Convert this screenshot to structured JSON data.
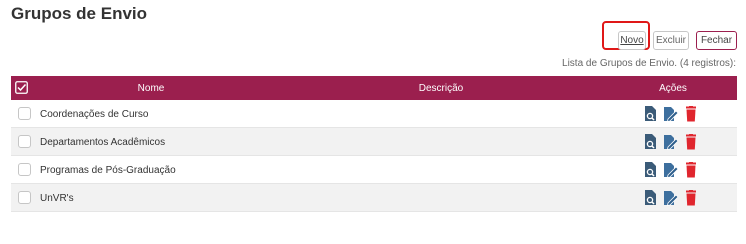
{
  "page": {
    "title": "Grupos de Envio"
  },
  "toolbar": {
    "new_label": "Novo",
    "delete_label": "Excluir",
    "close_label": "Fechar"
  },
  "list": {
    "caption": "Lista de Grupos de Envio. (4 registros):",
    "headers": {
      "name": "Nome",
      "description": "Descrição",
      "actions": "Ações"
    },
    "rows": [
      {
        "name": "Coordenações de Curso",
        "description": ""
      },
      {
        "name": "Departamentos Acadêmicos",
        "description": ""
      },
      {
        "name": "Programas de Pós-Graduação",
        "description": ""
      },
      {
        "name": "UnVR's",
        "description": ""
      }
    ]
  },
  "colors": {
    "header_bg": "#9b1f4e",
    "highlight": "#e01818",
    "view_icon": "#3b5b78",
    "edit_icon": "#3d6f9e",
    "delete_icon": "#e0262e"
  }
}
